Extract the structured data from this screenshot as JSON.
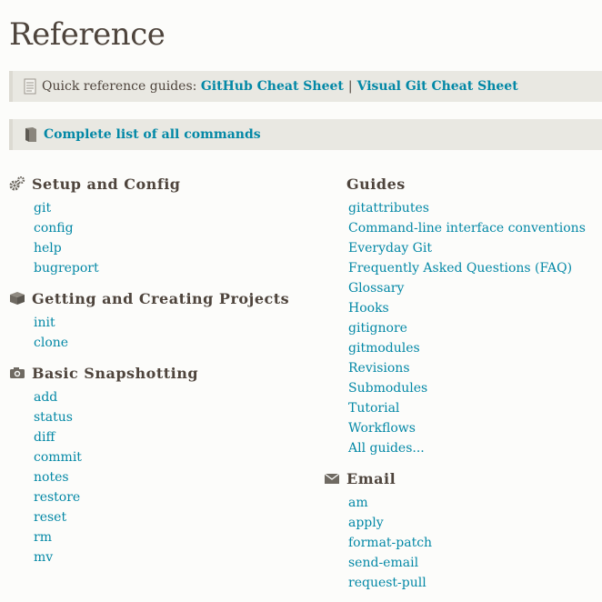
{
  "title": "Reference",
  "quick": {
    "label": "Quick reference guides:",
    "link1": "GitHub Cheat Sheet",
    "sep": "|",
    "link2": "Visual Git Cheat Sheet"
  },
  "complete": {
    "link": "Complete list of all commands"
  },
  "sections": {
    "setup": {
      "title": "Setup and Config",
      "items": [
        "git",
        "config",
        "help",
        "bugreport"
      ]
    },
    "projects": {
      "title": "Getting and Creating Projects",
      "items": [
        "init",
        "clone"
      ]
    },
    "snapshot": {
      "title": "Basic Snapshotting",
      "items": [
        "add",
        "status",
        "diff",
        "commit",
        "notes",
        "restore",
        "reset",
        "rm",
        "mv"
      ]
    },
    "guides": {
      "title": "Guides",
      "items": [
        "gitattributes",
        "Command-line interface conventions",
        "Everyday Git",
        "Frequently Asked Questions (FAQ)",
        "Glossary",
        "Hooks",
        "gitignore",
        "gitmodules",
        "Revisions",
        "Submodules",
        "Tutorial",
        "Workflows",
        "All guides..."
      ]
    },
    "email": {
      "title": "Email",
      "items": [
        "am",
        "apply",
        "format-patch",
        "send-email",
        "request-pull"
      ]
    }
  },
  "icons": {
    "quick": "document-icon",
    "complete": "book-icon",
    "setup": "gears-icon",
    "projects": "box-icon",
    "snapshot": "camera-icon",
    "email": "envelope-icon"
  },
  "colors": {
    "link": "#0388a6",
    "text": "#4e443c",
    "callout_bg": "#e9e8e2",
    "page_bg": "#fcfcfa"
  }
}
